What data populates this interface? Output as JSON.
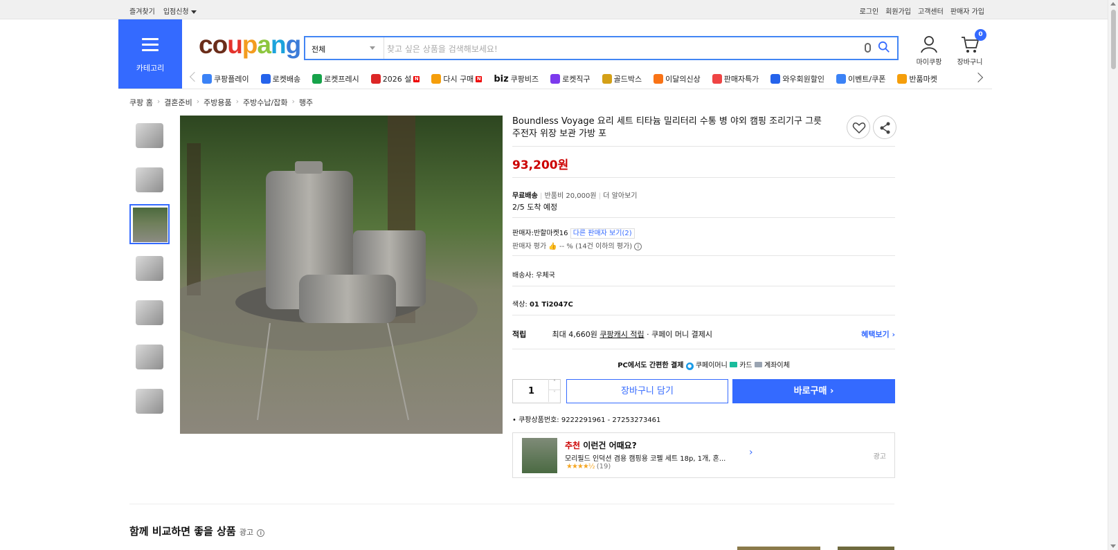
{
  "topbar": {
    "left": [
      "즐겨찾기",
      "입점신청"
    ],
    "right": [
      "로그인",
      "회원가입",
      "고객센터",
      "판매자 가입"
    ]
  },
  "header": {
    "category_label": "카테고리",
    "logo": "coupang",
    "search": {
      "category": "전체",
      "placeholder": "찾고 싶은 상품을 검색해보세요!"
    },
    "my_coupang": "마이쿠팡",
    "cart_label": "장바구니",
    "cart_count": "0"
  },
  "nav": [
    {
      "label": "쿠팡플레이",
      "icon": "play-icon",
      "color": "#3b82f6"
    },
    {
      "label": "로켓배송",
      "icon": "rocket-icon",
      "color": "#2563eb"
    },
    {
      "label": "로켓프레시",
      "icon": "rocket-fresh-icon",
      "color": "#16a34a"
    },
    {
      "label": "2026 설",
      "icon": "gift-icon",
      "color": "#dc2626",
      "badge": "N"
    },
    {
      "label": "다시 구매",
      "icon": "home-icon",
      "color": "#f59e0b",
      "badge": "N"
    },
    {
      "label": "쿠팡비즈",
      "icon": "biz-icon",
      "color": "#111111",
      "prefix": "biz"
    },
    {
      "label": "로켓직구",
      "icon": "rocket-global-icon",
      "color": "#7c3aed"
    },
    {
      "label": "골드박스",
      "icon": "goldbox-icon",
      "color": "#d4a017"
    },
    {
      "label": "이달의신상",
      "icon": "new-icon",
      "color": "#f97316"
    },
    {
      "label": "판매자특가",
      "icon": "percent-icon",
      "color": "#ef4444"
    },
    {
      "label": "와우회원할인",
      "icon": "wow-icon",
      "color": "#2563eb"
    },
    {
      "label": "이벤트/쿠폰",
      "icon": "coupon-icon",
      "color": "#3b82f6"
    },
    {
      "label": "반품마켓",
      "icon": "market-icon",
      "color": "#f59e0b"
    }
  ],
  "breadcrumb": [
    "쿠팡 홈",
    "결혼준비",
    "주방용품",
    "주방수납/잡화",
    "행주"
  ],
  "product": {
    "title": "Boundless Voyage 요리 세트 티타늄 밀리터리 수통 병 야외 캠핑 조리기구 그릇 주전자 위장 보관 가방 포",
    "price": "93,200원",
    "shipping_free": "무료배송",
    "return_fee": "반품비 20,000원",
    "learn_more": "더 알아보기",
    "arrival": "2/5 도착 예정",
    "seller_label": "판매자:",
    "seller_name": "반할마켓16",
    "other_sellers": "다른 판매자 보기(2)",
    "seller_rating_label": "판매자 평가",
    "seller_rating": "-- % (14건 이하의 평가)",
    "carrier_label": "배송사:",
    "carrier": "우체국",
    "color_label": "색상:",
    "color_value": "01 Ti2047C",
    "reward_label": "적립",
    "reward_text": "최대 4,660원",
    "reward_cash": "쿠팡캐시 적립",
    "reward_suffix": "· 쿠페이 머니 결제시",
    "benefit_link": "혜택보기",
    "pay_title": "PC에서도 간편한 결제",
    "pay_methods": [
      "쿠페이머니",
      "카드",
      "계좌이체"
    ],
    "quantity": "1",
    "add_to_cart": "장바구니 담기",
    "buy_now": "바로구매",
    "product_number": "쿠팡상품번호: 9222291961 - 27253273461"
  },
  "recommend": {
    "title_red": "추천",
    "title": "이런건 어때요?",
    "item": "모리필드 인덕션 겸용 캠핑용 코펠 세트 18p, 1개, 혼...",
    "reviews": "(19)",
    "ad": "광고"
  },
  "compare_section": {
    "title": "함께 비교하면 좋을 상품",
    "ad": "광고"
  },
  "colors": {
    "accent": "#346aff",
    "price": "#cc0000"
  }
}
